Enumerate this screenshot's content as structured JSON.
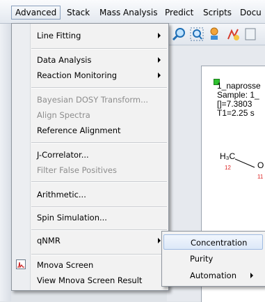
{
  "menubar": {
    "items": [
      "Advanced",
      "Stack",
      "Mass Analysis",
      "Predict",
      "Scripts",
      "Docu"
    ]
  },
  "advanced_menu": {
    "line_fitting": "Line Fitting",
    "data_analysis": "Data Analysis",
    "reaction_monitoring": "Reaction Monitoring",
    "bayesian_dosy": "Bayesian DOSY Transform...",
    "align_spectra": "Align Spectra",
    "reference_alignment": "Reference Alignment",
    "j_correlator": "J-Correlator...",
    "filter_false_positives": "Filter False Positives",
    "arithmetic": "Arithmetic...",
    "spin_simulation": "Spin Simulation...",
    "qnmr": "qNMR",
    "mnova_screen": "Mnova Screen",
    "view_mnova_screen_result": "View Mnova Screen Result"
  },
  "qnmr_submenu": {
    "concentration": "Concentration",
    "purity": "Purity",
    "automation": "Automation"
  },
  "document": {
    "line1": "1_naprosse",
    "line2": "Sample: 1_",
    "line3": "[]=7.3803",
    "line4": "T1=2.25 s",
    "methyl_label": "H₃C",
    "methyl_number": "12",
    "oxygen_label": "O",
    "oxygen_number": "11"
  },
  "colors": {
    "highlight_border": "#9fbbe2",
    "menu_background": "#f2f2f2",
    "disabled_text": "#8d8d8d"
  }
}
